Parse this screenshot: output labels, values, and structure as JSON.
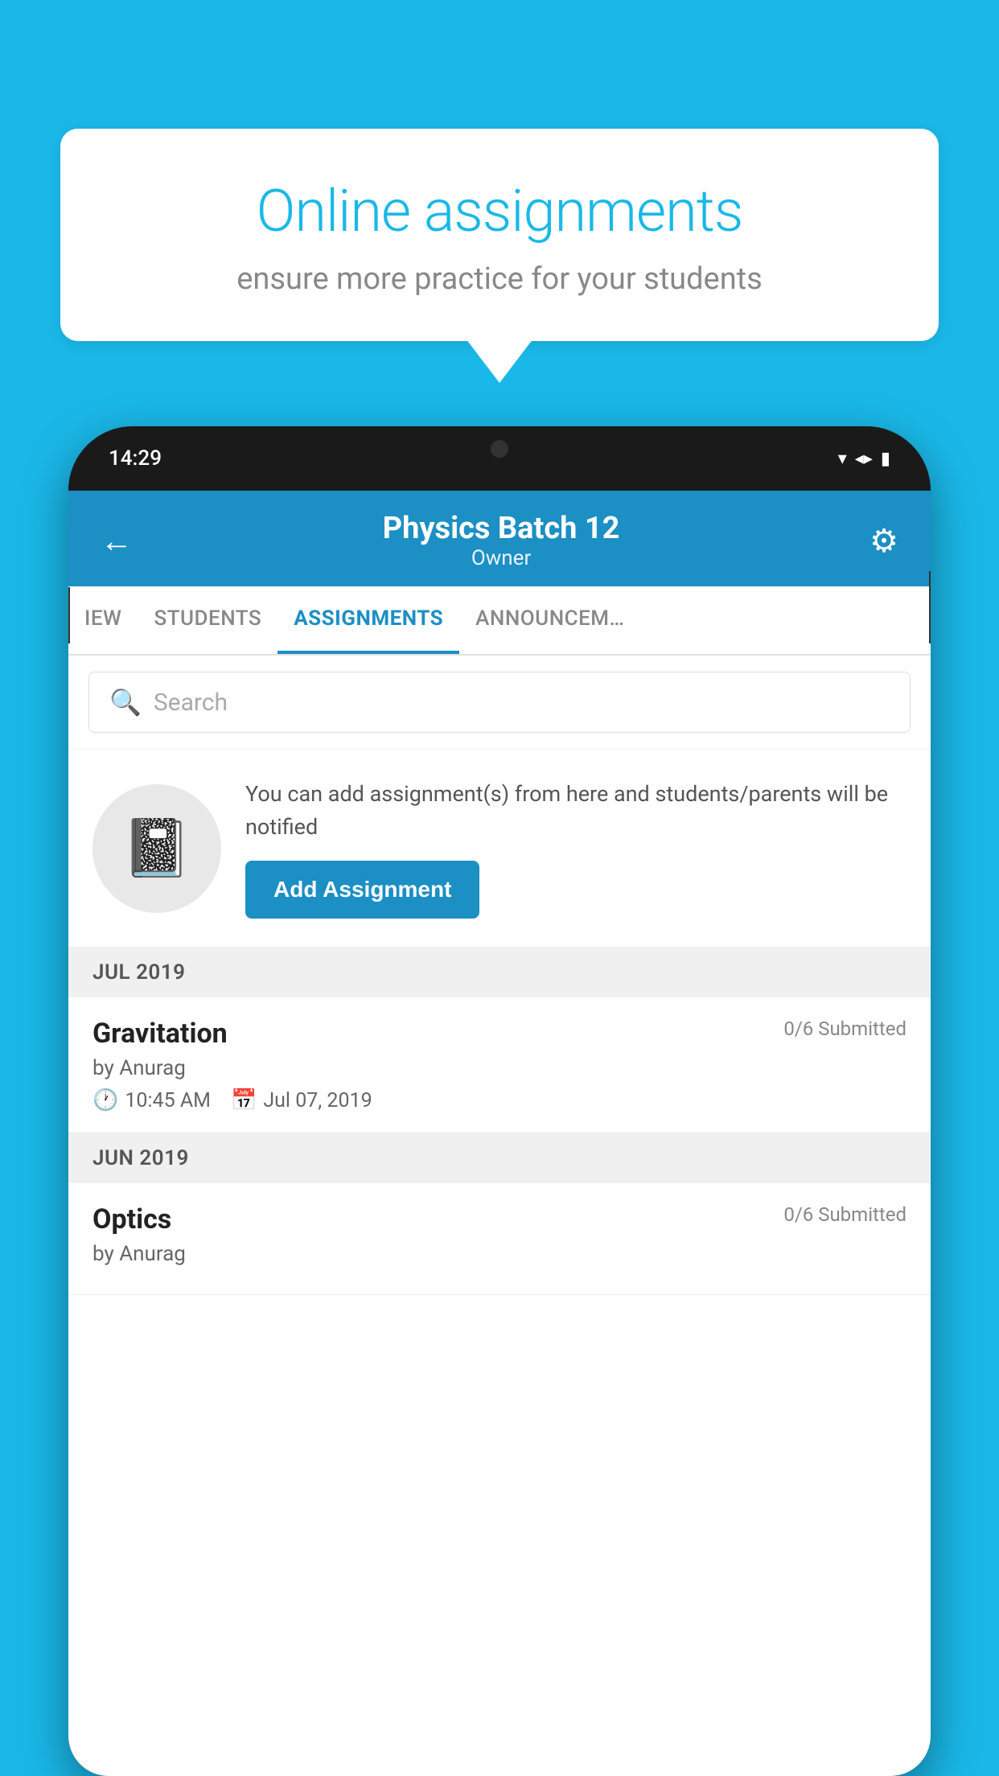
{
  "background_color": "#1ab8e8",
  "bubble": {
    "title": "Online assignments",
    "subtitle": "ensure more practice for your students"
  },
  "phone": {
    "status_bar": {
      "time": "14:29"
    },
    "header": {
      "title": "Physics Batch 12",
      "subtitle": "Owner",
      "back_label": "←",
      "gear_label": "⚙"
    },
    "tabs": [
      {
        "label": "IEW",
        "active": false
      },
      {
        "label": "STUDENTS",
        "active": false
      },
      {
        "label": "ASSIGNMENTS",
        "active": true
      },
      {
        "label": "ANNOUNCEM…",
        "active": false
      }
    ],
    "search": {
      "placeholder": "Search"
    },
    "promo": {
      "text": "You can add assignment(s) from here and students/parents will be notified",
      "button_label": "Add Assignment"
    },
    "sections": [
      {
        "month": "JUL 2019",
        "assignments": [
          {
            "name": "Gravitation",
            "submitted": "0/6 Submitted",
            "by": "by Anurag",
            "time": "10:45 AM",
            "date": "Jul 07, 2019"
          }
        ]
      },
      {
        "month": "JUN 2019",
        "assignments": [
          {
            "name": "Optics",
            "submitted": "0/6 Submitted",
            "by": "by Anurag",
            "time": "",
            "date": ""
          }
        ]
      }
    ]
  }
}
